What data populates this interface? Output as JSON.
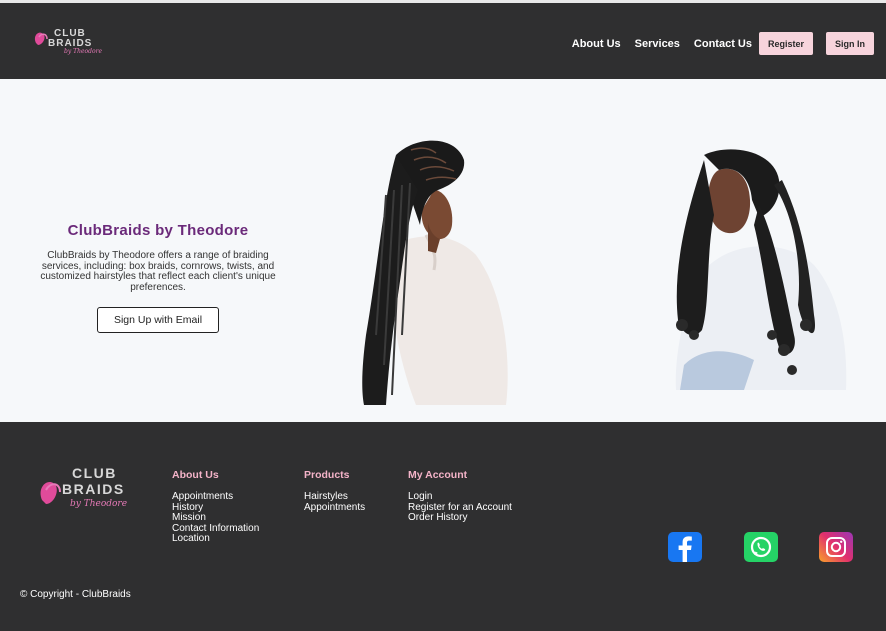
{
  "header": {
    "logo_text_top": "CLUB",
    "logo_text_mid": "BRAIDS",
    "logo_text_sub": "by Theodore",
    "nav": [
      {
        "label": "About Us"
      },
      {
        "label": "Services"
      },
      {
        "label": "Contact Us"
      }
    ],
    "register_label": "Register",
    "signin_label": "Sign In"
  },
  "hero": {
    "title": "ClubBraids by Theodore",
    "description": "ClubBraids by Theodore offers a range of braiding services, including: box braids, cornrows, twists, and customized hairstyles that reflect each client's unique preferences.",
    "signup_label": "Sign Up with Email"
  },
  "footer": {
    "logo_text_top": "CLUB",
    "logo_text_mid": "BRAIDS",
    "logo_text_sub": "by Theodore",
    "columns": [
      {
        "title": "About Us",
        "items": [
          "Appointments",
          "History",
          "Mission",
          "Contact Information",
          "Location"
        ]
      },
      {
        "title": "Products",
        "items": [
          "Hairstyles",
          "Appointments"
        ]
      },
      {
        "title": "My Account",
        "items": [
          "Login",
          "Register for an Account",
          "Order History"
        ]
      }
    ],
    "social": [
      "facebook-icon",
      "whatsapp-icon",
      "instagram-icon"
    ],
    "copyright": "© Copyright - ClubBraids"
  },
  "colors": {
    "header_bg": "#2f2f30",
    "accent_pink": "#f7d4dc",
    "title_purple": "#6b2a7a",
    "footer_title_pink": "#f4b3c8"
  }
}
